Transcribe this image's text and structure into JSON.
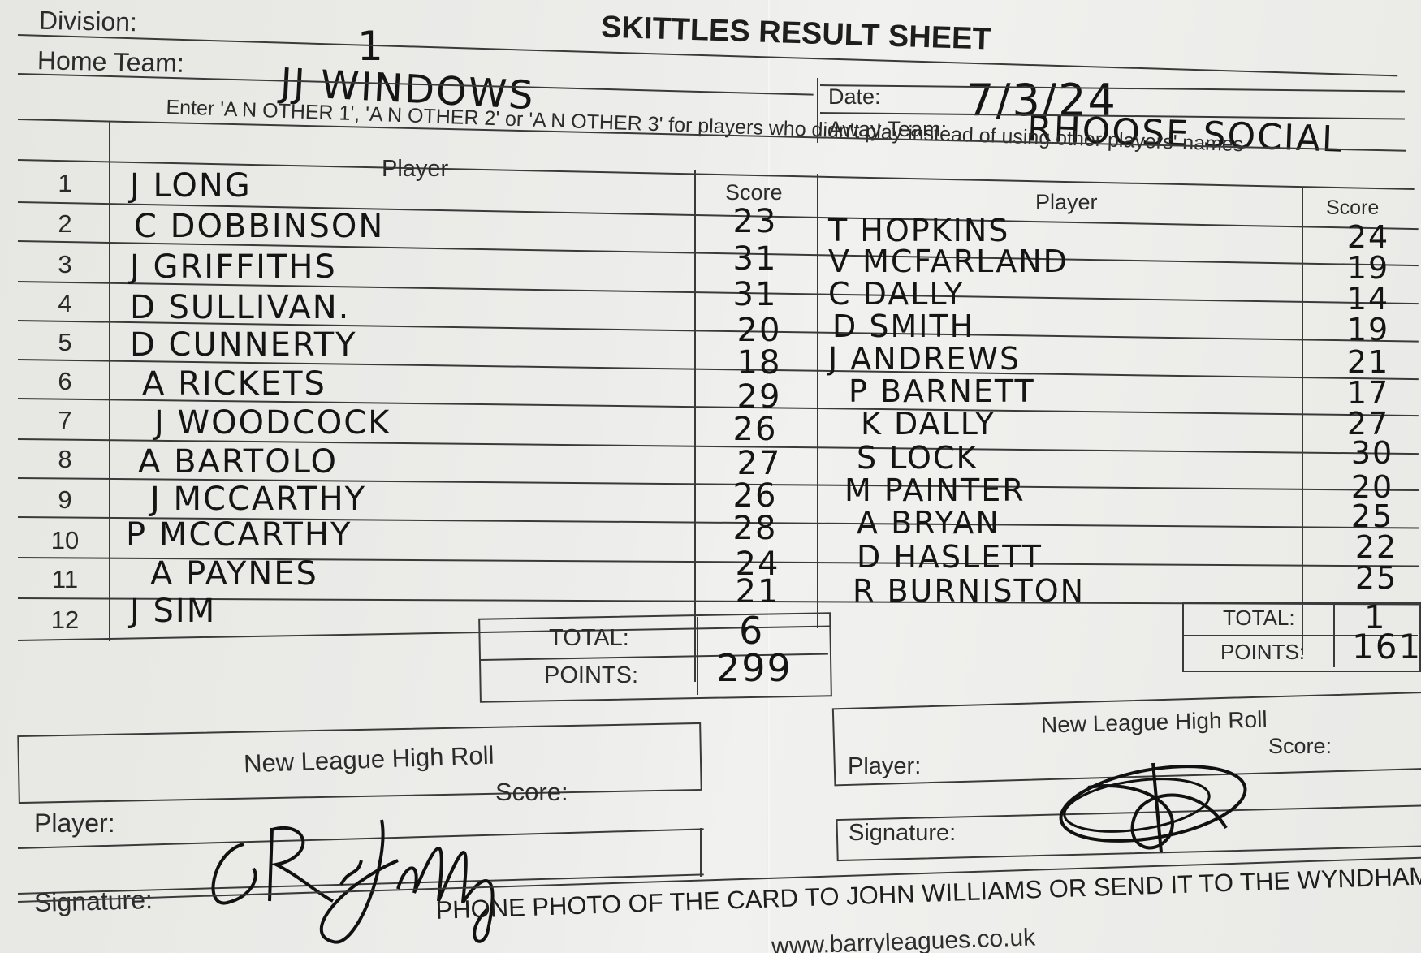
{
  "sheet": {
    "title": "SKITTLES RESULT SHEET",
    "division_label": "Division:",
    "division_value": "1",
    "home_team_label": "Home Team:",
    "home_team_value": "JJ WINDOWS",
    "date_label": "Date:",
    "date_value": "7/3/24",
    "away_team_label": "Away Team:",
    "away_team_value": "RHOOSE SOCIAL",
    "instruction": "Enter 'A N OTHER 1', 'A N OTHER 2' or 'A N OTHER 3' for players who didn't play instead of using other players' names",
    "player_header": "Player",
    "score_header": "Score"
  },
  "home": {
    "rows": [
      {
        "num": "1",
        "name": "J LONG",
        "score": "23"
      },
      {
        "num": "2",
        "name": "C DOBBINSON",
        "score": "31"
      },
      {
        "num": "3",
        "name": "J GRIFFITHS",
        "score": "31"
      },
      {
        "num": "4",
        "name": "D SULLIVAN.",
        "score": "20"
      },
      {
        "num": "5",
        "name": "D CUNNERTY",
        "score": "18"
      },
      {
        "num": "6",
        "name": "A RICKETS",
        "score": "29"
      },
      {
        "num": "7",
        "name": "J WOODCOCK",
        "score": "26"
      },
      {
        "num": "8",
        "name": "A BARTOLO",
        "score": "27"
      },
      {
        "num": "9",
        "name": "J MCCARTHY",
        "score": "26"
      },
      {
        "num": "10",
        "name": "P MCCARTHY",
        "score": "28"
      },
      {
        "num": "11",
        "name": "A PAYNES",
        "score": "24"
      },
      {
        "num": "12",
        "name": "J SIM",
        "score": "21"
      }
    ],
    "total_label": "TOTAL:",
    "total_value": "6",
    "points_label": "POINTS:",
    "points_value": "299"
  },
  "away": {
    "rows": [
      {
        "name": "T HOPKINS",
        "score": "24"
      },
      {
        "name": "V MCFARLAND",
        "score": "19"
      },
      {
        "name": "C DALLY",
        "score": "14"
      },
      {
        "name": "D SMITH",
        "score": "19"
      },
      {
        "name": "J ANDREWS",
        "score": "21"
      },
      {
        "name": "P BARNETT",
        "score": "17"
      },
      {
        "name": "K DALLY",
        "score": "27"
      },
      {
        "name": "S LOCK",
        "score": "30"
      },
      {
        "name": "M PAINTER",
        "score": "20"
      },
      {
        "name": "A BRYAN",
        "score": "25"
      },
      {
        "name": "D HASLETT",
        "score": "22"
      },
      {
        "name": "R BURNISTON",
        "score": "25"
      }
    ],
    "total_label": "TOTAL:",
    "total_value": "1",
    "points_label": "POINTS:",
    "points_value": "161"
  },
  "high_roll": {
    "title": "New League High Roll",
    "score_label": "Score:",
    "player_label": "Player:",
    "signature_label": "Signature:"
  },
  "footer": {
    "line1": "PHONE PHOTO OF THE CARD TO JOHN WILLIAMS OR SEND IT TO THE WYNDHAM",
    "line2": "www.barryleagues.co.uk"
  }
}
